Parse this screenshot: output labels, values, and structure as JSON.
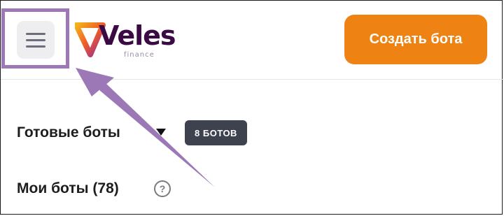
{
  "header": {
    "menu_icon": "hamburger-menu-icon",
    "logo": {
      "word": "Veles",
      "sub": "finance"
    },
    "create_button_label": "Создать бота"
  },
  "sections": {
    "ready_bots": {
      "title": "Готовые боты",
      "badge": "8 БОТОВ",
      "toggle_icon": "caret-down-icon"
    },
    "my_bots": {
      "title": "Мои боты (78)",
      "help_icon": "question-circle-icon",
      "help_glyph": "?"
    }
  },
  "annotation": {
    "color": "#9c79b6"
  },
  "colors": {
    "accent": "#ee8313",
    "badge_bg": "#3e414e",
    "logo_dark": "#3b0a45"
  }
}
